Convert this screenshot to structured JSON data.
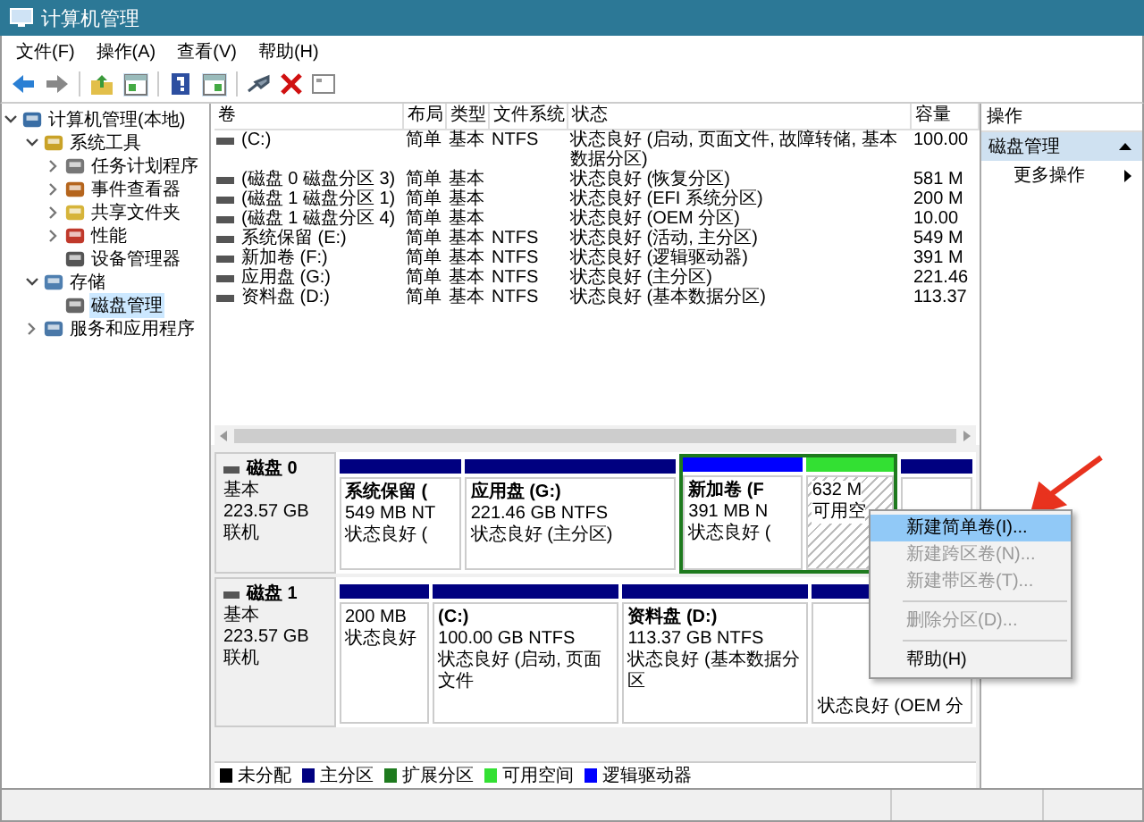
{
  "window": {
    "title": "计算机管理"
  },
  "menu": [
    "文件(F)",
    "操作(A)",
    "查看(V)",
    "帮助(H)"
  ],
  "tree": [
    {
      "label": "计算机管理(本地)",
      "expanded": true,
      "selected": false,
      "children": [
        {
          "label": "系统工具",
          "expanded": true,
          "selected": false,
          "children": [
            {
              "label": "任务计划程序",
              "expanded": false,
              "selected": false
            },
            {
              "label": "事件查看器",
              "expanded": false,
              "selected": false
            },
            {
              "label": "共享文件夹",
              "expanded": false,
              "selected": false
            },
            {
              "label": "性能",
              "expanded": false,
              "selected": false
            },
            {
              "label": "设备管理器",
              "selected": false
            }
          ]
        },
        {
          "label": "存储",
          "expanded": true,
          "selected": false,
          "children": [
            {
              "label": "磁盘管理",
              "selected": true
            }
          ]
        },
        {
          "label": "服务和应用程序",
          "expanded": false,
          "selected": false
        }
      ]
    }
  ],
  "table": {
    "columns": [
      "卷",
      "布局",
      "类型",
      "文件系统",
      "状态",
      "容量"
    ],
    "rows": [
      [
        "(C:)",
        "简单",
        "基本",
        "NTFS",
        "状态良好 (启动, 页面文件, 故障转储, 基本数据分区)",
        "100.00"
      ],
      [
        "(磁盘 0 磁盘分区 3)",
        "简单",
        "基本",
        "",
        "状态良好 (恢复分区)",
        "581 M"
      ],
      [
        "(磁盘 1 磁盘分区 1)",
        "简单",
        "基本",
        "",
        "状态良好 (EFI 系统分区)",
        "200 M"
      ],
      [
        "(磁盘 1 磁盘分区 4)",
        "简单",
        "基本",
        "",
        "状态良好 (OEM 分区)",
        "10.00"
      ],
      [
        "系统保留 (E:)",
        "简单",
        "基本",
        "NTFS",
        "状态良好 (活动, 主分区)",
        "549 M"
      ],
      [
        "新加卷 (F:)",
        "简单",
        "基本",
        "NTFS",
        "状态良好 (逻辑驱动器)",
        "391 M"
      ],
      [
        "应用盘 (G:)",
        "简单",
        "基本",
        "NTFS",
        "状态良好 (主分区)",
        "221.46"
      ],
      [
        "资料盘 (D:)",
        "简单",
        "基本",
        "NTFS",
        "状态良好 (基本数据分区)",
        "113.37"
      ]
    ]
  },
  "disks": [
    {
      "name": "磁盘 0",
      "type": "基本",
      "size": "223.57 GB",
      "status": "联机",
      "partitions": [
        {
          "kind": "primary",
          "selected": false,
          "lines": [
            "系统保留 (",
            "549 MB NT",
            "状态良好 ("
          ]
        },
        {
          "kind": "primary",
          "selected": false,
          "lines": [
            "应用盘 (G:)",
            "221.46 GB NTFS",
            "状态良好 (主分区)"
          ]
        },
        {
          "kind": "extended",
          "children": [
            {
              "kind": "logical",
              "selected": false,
              "lines": [
                "新加卷 (F",
                "391 MB N",
                "状态良好 ("
              ]
            },
            {
              "kind": "free",
              "selected": true,
              "lines": [
                "632 M",
                "可用空"
              ]
            }
          ]
        },
        {
          "kind": "primary",
          "selected": false
        }
      ]
    },
    {
      "name": "磁盘 1",
      "type": "基本",
      "size": "223.57 GB",
      "status": "联机",
      "partitions": [
        {
          "kind": "primary",
          "selected": false,
          "lines": [
            "200 MB",
            "状态良好"
          ]
        },
        {
          "kind": "primary",
          "selected": false,
          "lines": [
            "(C:)",
            "100.00 GB NTFS",
            "状态良好 (启动, 页面文件"
          ]
        },
        {
          "kind": "primary",
          "selected": false,
          "lines": [
            "资料盘 (D:)",
            "113.37 GB NTFS",
            "状态良好 (基本数据分区"
          ]
        },
        {
          "kind": "primary",
          "selected": false,
          "lines": [
            "状态良好 (OEM 分"
          ]
        }
      ]
    }
  ],
  "legend": [
    {
      "label": "未分配",
      "color": "#000000"
    },
    {
      "label": "主分区",
      "color": "#000080"
    },
    {
      "label": "扩展分区",
      "color": "#1e7a1e"
    },
    {
      "label": "可用空间",
      "color": "#33e033"
    },
    {
      "label": "逻辑驱动器",
      "color": "#0000ff"
    }
  ],
  "actions": {
    "title": "操作",
    "section": "磁盘管理",
    "items": [
      "更多操作"
    ]
  },
  "context_menu": [
    {
      "kind": "item",
      "label": "新建简单卷(I)...",
      "disabled": false,
      "selected": true
    },
    {
      "kind": "item",
      "label": "新建跨区卷(N)...",
      "disabled": true,
      "selected": false
    },
    {
      "kind": "item",
      "label": "新建带区卷(T)...",
      "disabled": true,
      "selected": false
    },
    {
      "kind": "separator"
    },
    {
      "kind": "item",
      "label": "删除分区(D)...",
      "disabled": true,
      "selected": false
    },
    {
      "kind": "separator"
    },
    {
      "kind": "item",
      "label": "帮助(H)",
      "disabled": false,
      "selected": false
    }
  ]
}
